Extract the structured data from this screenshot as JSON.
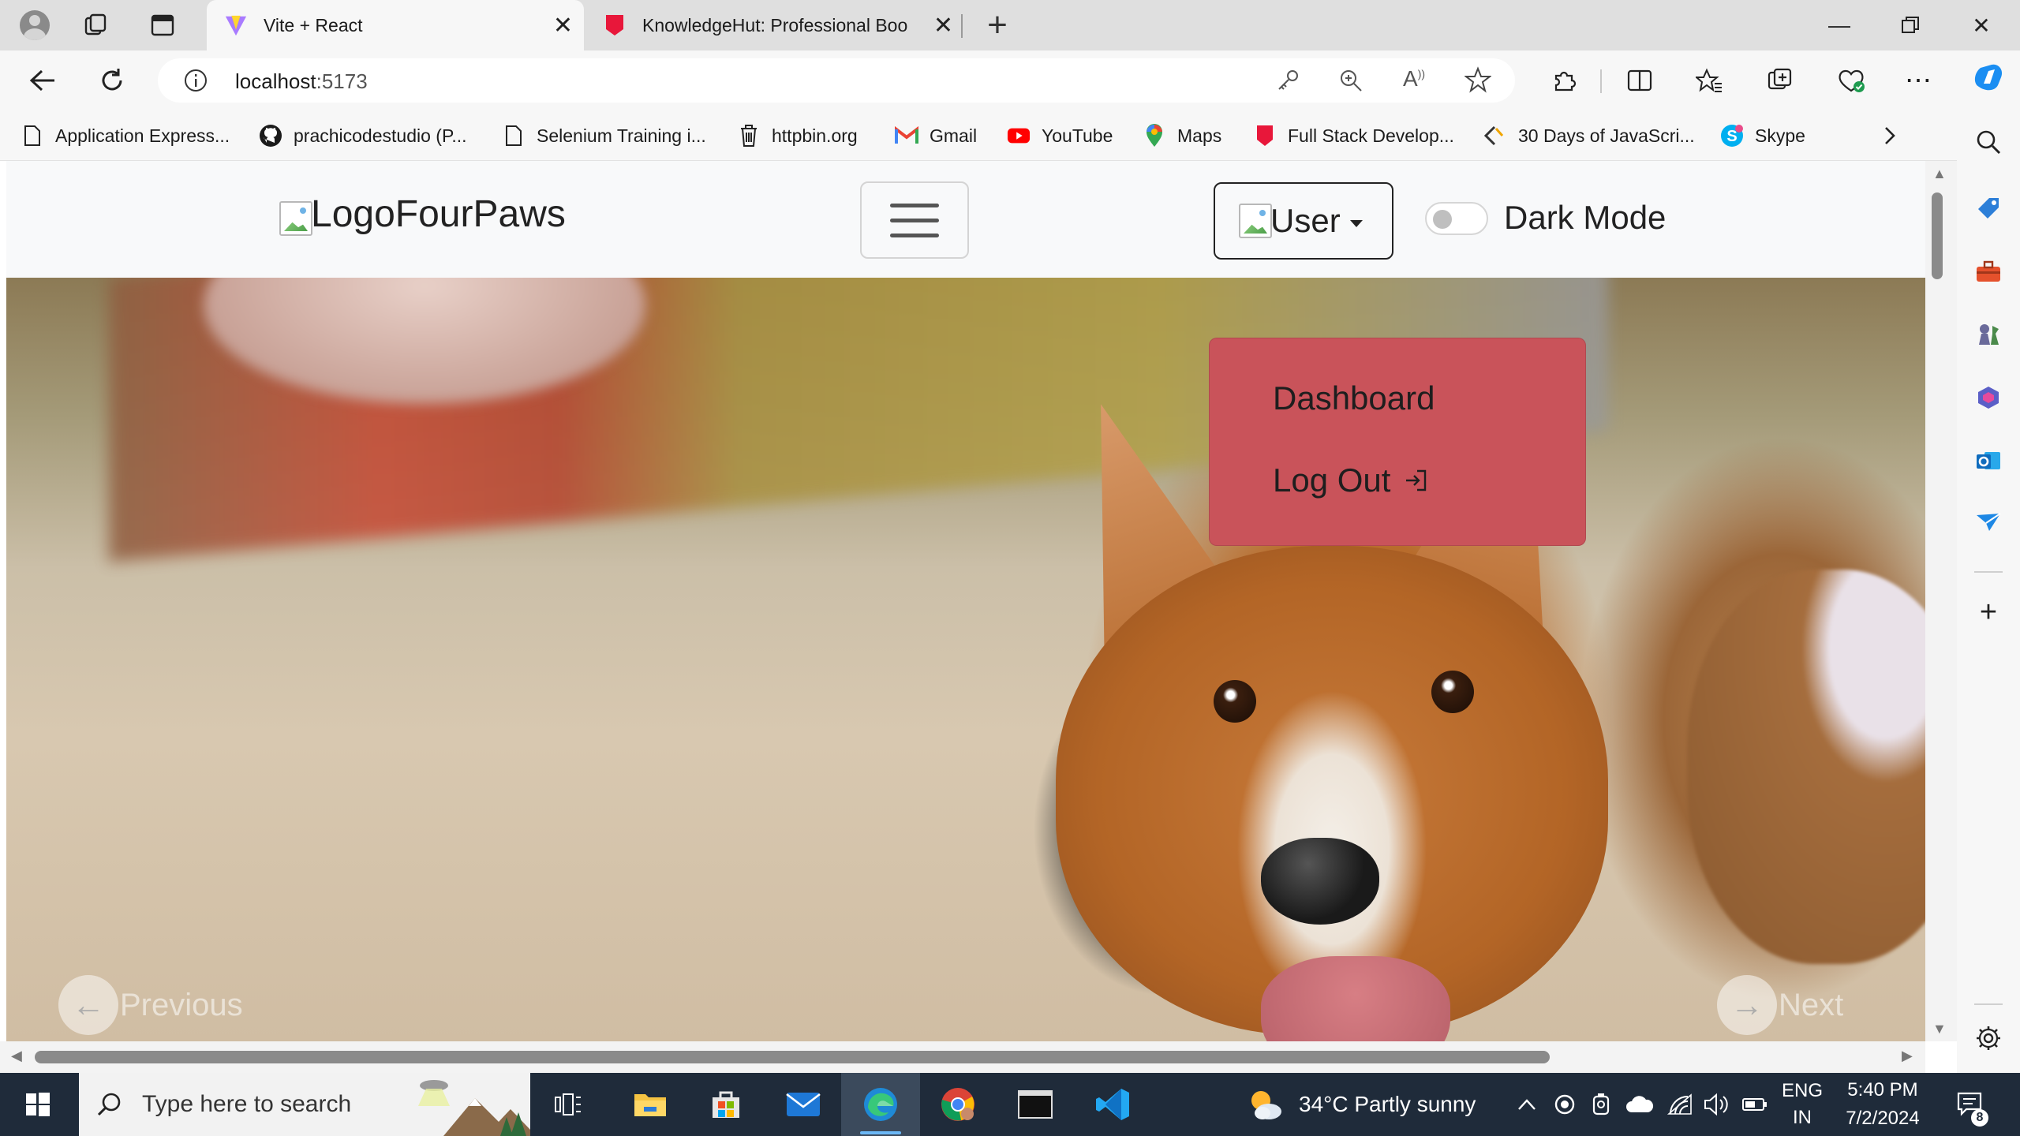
{
  "browser": {
    "tabs": [
      {
        "title": "Vite + React",
        "active": true
      },
      {
        "title": "KnowledgeHut: Professional Boo",
        "active": false
      }
    ],
    "url": {
      "host": "localhost",
      "port": ":5173"
    },
    "bookmarks": [
      {
        "label": "Application Express...",
        "icon": "page-icon"
      },
      {
        "label": "prachicodestudio (P...",
        "icon": "github-icon"
      },
      {
        "label": "Selenium Training i...",
        "icon": "page-icon"
      },
      {
        "label": "httpbin.org",
        "icon": "trash-icon"
      },
      {
        "label": "Gmail",
        "icon": "gmail-icon"
      },
      {
        "label": "YouTube",
        "icon": "youtube-icon"
      },
      {
        "label": "Maps",
        "icon": "maps-icon"
      },
      {
        "label": "Full Stack Develop...",
        "icon": "knowledgehut-icon"
      },
      {
        "label": "30 Days of JavaScri...",
        "icon": "code-icon"
      },
      {
        "label": "Skype",
        "icon": "skype-icon"
      }
    ]
  },
  "page": {
    "logo_alt": "Logo",
    "brand": "FourPaws",
    "user_alt": "User",
    "dark_mode_label": "Dark Mode",
    "dropdown": {
      "dashboard": "Dashboard",
      "logout": "Log Out"
    },
    "carousel": {
      "previous": "Previous",
      "next": "Next"
    }
  },
  "taskbar": {
    "search_placeholder": "Type here to search",
    "weather": "34°C  Partly sunny",
    "lang_line1": "ENG",
    "lang_line2": "IN",
    "time": "5:40 PM",
    "date": "7/2/2024",
    "notifications": "8"
  },
  "colors": {
    "dropdown_bg": "#c9535a",
    "taskbar_bg": "#1f2b3a"
  }
}
